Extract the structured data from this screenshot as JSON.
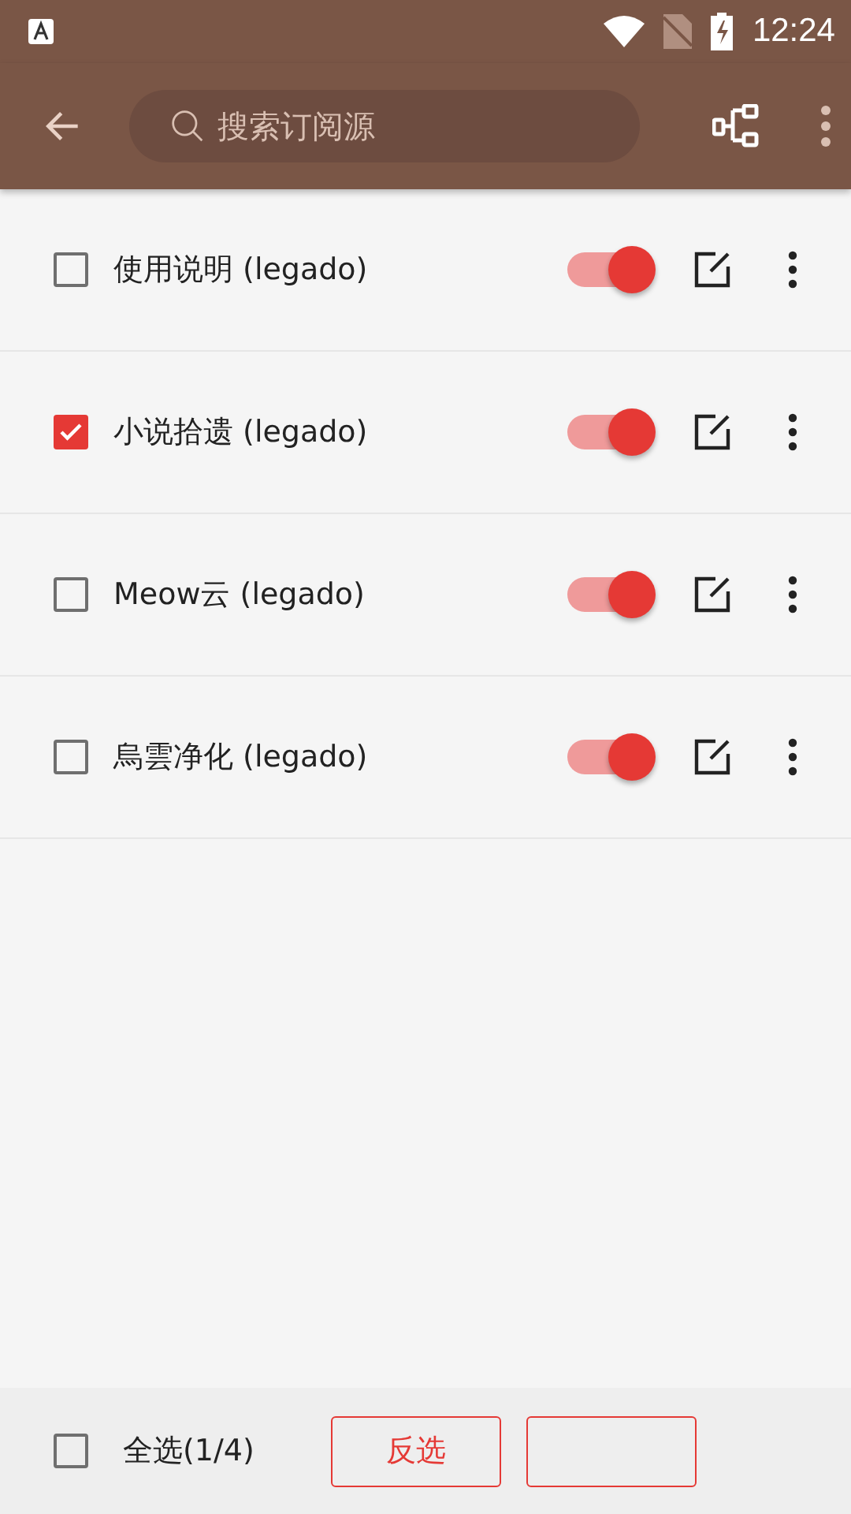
{
  "status_bar": {
    "time": "12:24"
  },
  "toolbar": {
    "search": {
      "placeholder": "搜索订阅源"
    }
  },
  "sources": [
    {
      "name": "使用说明 (legado)",
      "checked": false,
      "on": true
    },
    {
      "name": "小说拾遗 (legado)",
      "checked": true,
      "on": true
    },
    {
      "name": "Meow云 (legado)",
      "checked": false,
      "on": true
    },
    {
      "name": "烏雲净化 (legado)",
      "checked": false,
      "on": true
    }
  ],
  "bottom_bar": {
    "select_all": {
      "label": "全选(1/4)",
      "checked": false
    },
    "buttons": [
      {
        "kind": "outlined",
        "label": "反选"
      },
      {
        "kind": "outlined"
      }
    ]
  }
}
